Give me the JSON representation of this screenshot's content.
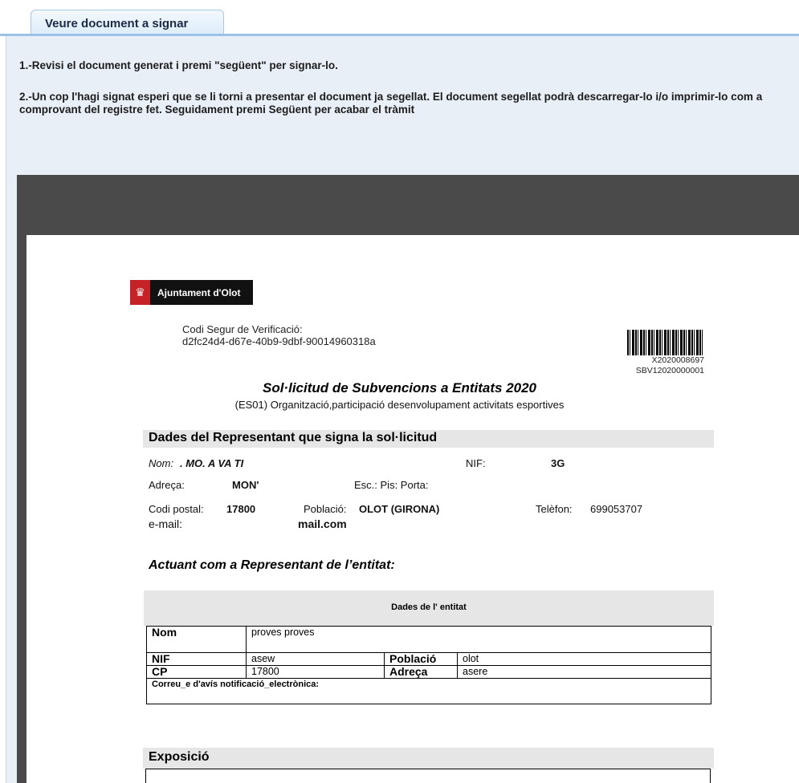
{
  "tab": {
    "label": "Veure document a signar"
  },
  "instructions": {
    "step1": "1.-Revisi el document generat i premi \"següent\" per signar-lo.",
    "step2": "2.-Un cop l'hagi signat esperi que se li torni a presentar el document ja segellat. El document segellat podrà descarregar-lo i/o imprimir-lo com a comprovant del registre fet. Seguidament premi Següent per acabar el tràmit"
  },
  "document": {
    "logo_text": "Ajuntament d'Olot",
    "csv_label": "Codi Segur de Verificació:",
    "csv_code": "d2fc24d4-d67e-40b9-9dbf-90014960318a",
    "barcode_num1": "X2020008697",
    "barcode_num2": "SBV12020000001",
    "title": "Sol·licitud de Subvencions a Entitats 2020",
    "subtitle": "(ES01) Organització,participació desenvolupament activitats esportives",
    "representant": {
      "section_title": "Dades del Representant que signa la sol·licitud",
      "nom_label": "Nom:",
      "nom_value": ".   MO.      A  VA        TI",
      "nif_label": "NIF:",
      "nif_value": "3G",
      "adreca_label": "Adreça:",
      "adreca_value": "MON'",
      "esc_label": "Esc.: Pis: Porta:",
      "cp_label": "Codi postal:",
      "cp_value": "17800",
      "poblacio_label": "Població:",
      "poblacio_value": "OLOT (GIRONA)",
      "telefon_label": "Telèfon:",
      "telefon_value": "699053707",
      "email_label": "e-mail:",
      "email_value": "mail.com"
    },
    "actuant": "Actuant com a Representant de l’entitat:",
    "entitat": {
      "title": "Dades de l' entitat",
      "nom_label": "Nom",
      "nom_value": "proves  proves",
      "nif_label": "NIF",
      "nif_value": "asew",
      "poblacio_label": "Població",
      "poblacio_value": "olot",
      "cp_label": "CP",
      "cp_value": "17800",
      "adreca_label": "Adreça",
      "adreca_value": "asere",
      "correu_label": "Correu_e d'avís notificació_electrònica:"
    },
    "exposicio_title": "Exposició"
  }
}
